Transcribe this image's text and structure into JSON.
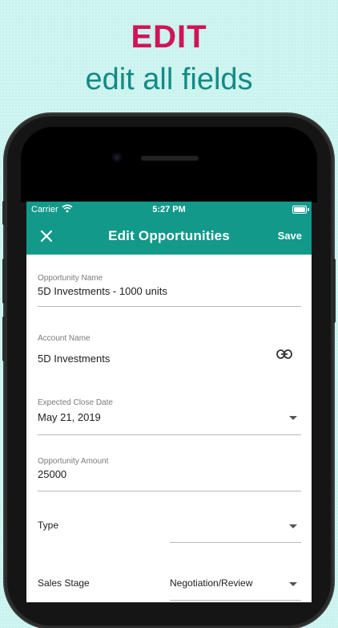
{
  "promo": {
    "title": "EDIT",
    "subtitle": "edit all fields"
  },
  "status_bar": {
    "carrier": "Carrier",
    "time": "5:27 PM"
  },
  "app_bar": {
    "title": "Edit Opportunities",
    "save_label": "Save"
  },
  "form": {
    "opportunity_name": {
      "label": "Opportunity Name",
      "value": "5D Investments - 1000 units"
    },
    "account_name": {
      "label": "Account Name",
      "value": "5D Investments"
    },
    "expected_close_date": {
      "label": "Expected Close Date",
      "value": "May 21, 2019"
    },
    "opportunity_amount": {
      "label": "Opportunity Amount",
      "value": "25000"
    },
    "type": {
      "label": "Type",
      "value": ""
    },
    "sales_stage": {
      "label": "Sales Stage",
      "value": "Negotiation/Review"
    }
  },
  "colors": {
    "accent": "#12998a",
    "promo_title": "#d0145a",
    "promo_subtitle": "#138a86",
    "background": "#c9f3ee"
  }
}
